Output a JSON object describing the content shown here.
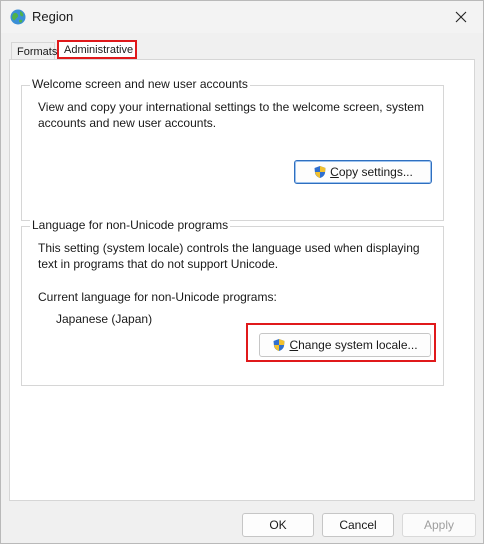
{
  "window": {
    "title": "Region",
    "app_icon": "globe-icon",
    "close_icon": "close-icon"
  },
  "tabs": [
    {
      "label": "Formats",
      "selected": false
    },
    {
      "label": "Administrative",
      "selected": true
    }
  ],
  "welcome_group": {
    "legend": "Welcome screen and new user accounts",
    "description": "View and copy your international settings to the welcome screen, system accounts and new user accounts.",
    "copy_button": {
      "icon": "uac-shield-icon",
      "mnemonic": "C",
      "label_rest": "opy settings..."
    }
  },
  "unicode_group": {
    "legend": "Language for non-Unicode programs",
    "description": "This setting (system locale) controls the language used when displaying text in programs that do not support Unicode.",
    "current_label": "Current language for non-Unicode programs:",
    "current_value": "Japanese (Japan)",
    "change_button": {
      "icon": "uac-shield-icon",
      "mnemonic": "C",
      "label_rest": "hange system locale..."
    }
  },
  "footer": {
    "ok": "OK",
    "cancel": "Cancel",
    "apply": "Apply",
    "apply_enabled": false
  },
  "colors": {
    "highlight": "#e0191b",
    "accent": "#2f6fbf"
  }
}
